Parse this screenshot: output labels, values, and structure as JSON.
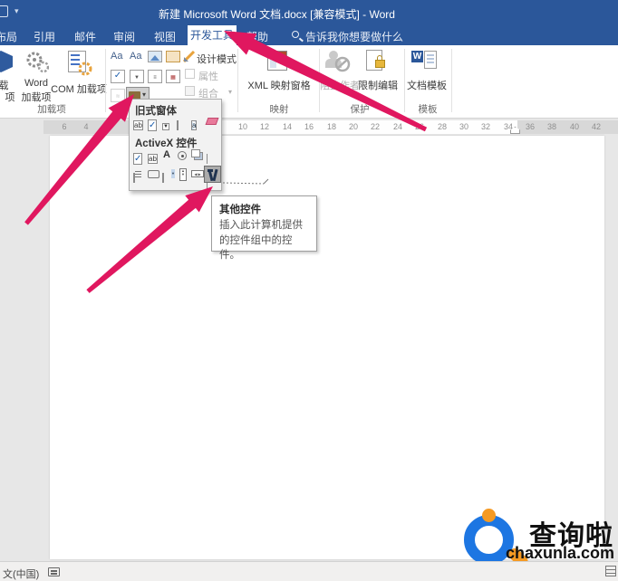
{
  "window": {
    "title": "新建 Microsoft Word 文档.docx [兼容模式]  -  Word"
  },
  "tabs": {
    "layout": "布局",
    "references": "引用",
    "mailings": "邮件",
    "review": "审阅",
    "view": "视图",
    "developer": "开发工具",
    "help": "帮助",
    "search_hint": "告诉我你想要做什么"
  },
  "ribbon": {
    "addins": {
      "group_label": "加载项",
      "store_l1": "载",
      "store_l2": "项",
      "word_addins_l1": "Word",
      "word_addins_l2": "加载项",
      "com_addins": "COM 加载项"
    },
    "controls": {
      "design_mode": "设计模式",
      "properties": "属性",
      "group": "组合"
    },
    "mapping": {
      "group_label": "映射",
      "xml_pane": "XML 映射窗格"
    },
    "protect": {
      "group_label": "保护",
      "block_authors": "阻止作者",
      "restrict_editing": "限制编辑"
    },
    "templates": {
      "group_label": "模板",
      "doc_template": "文档模板"
    }
  },
  "legacy_dropdown": {
    "legacy_header": "旧式窗体",
    "activex_header": "ActiveX 控件"
  },
  "tooltip": {
    "title": "其他控件",
    "body": "插入此计算机提供的控件组中的控件。"
  },
  "ruler": {
    "left": [
      "6",
      "4",
      "2"
    ],
    "middle": [
      "10",
      "12",
      "14",
      "16",
      "18",
      "20",
      "22",
      "24",
      "26",
      "28",
      "30",
      "32",
      "34"
    ],
    "right": [
      "36",
      "38",
      "40",
      "42"
    ]
  },
  "status": {
    "language": "文(中国)"
  },
  "watermark": {
    "brand": "查询啦",
    "domain": "chaxunla.com"
  },
  "glyphs": {
    "check": "✓",
    "up": "▲",
    "down": "▼",
    "left": "◀",
    "right": "▶",
    "caret": "▾",
    "ab": "ab",
    "Aa": "Aa",
    "A": "A",
    "a": "a",
    "W": "W"
  },
  "colors": {
    "titlebar": "#2b579a",
    "arrow": "#e0175f",
    "logo_blue": "#1d76e2",
    "logo_orange": "#f59a23"
  }
}
